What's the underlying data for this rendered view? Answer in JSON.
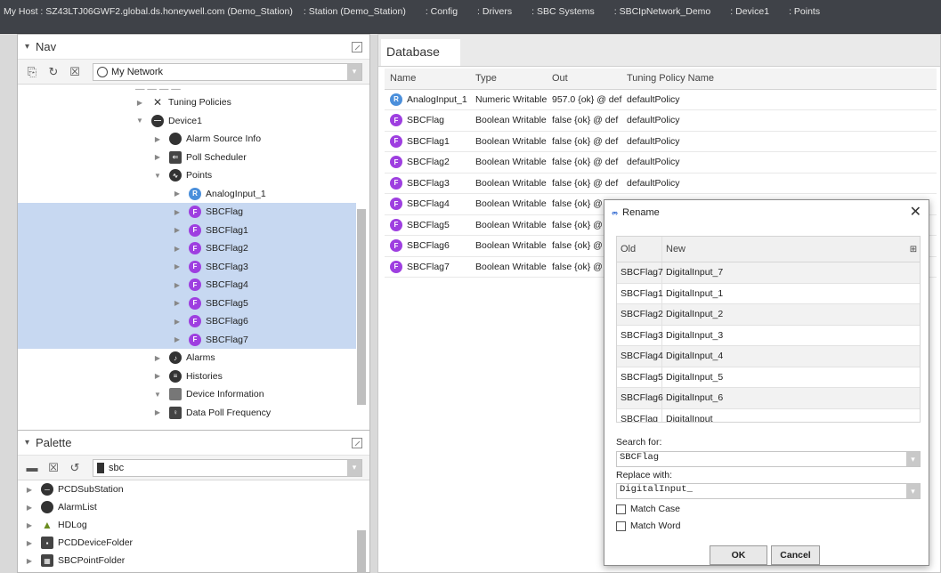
{
  "breadcrumb": [
    "My Host : SZ43LTJ06GWF2.global.ds.honeywell.com (Demo_Station)",
    ": Station (Demo_Station)",
    ": Config",
    ": Drivers",
    ": SBC Systems",
    ": SBCIpNetwork_Demo",
    ": Device1",
    ": Points"
  ],
  "nav": {
    "title": "Nav",
    "network_select": "My Network",
    "tree": [
      {
        "label": "Tuning Policies",
        "icon": "tuning-icon"
      },
      {
        "label": "Device1",
        "icon": "device-icon"
      },
      {
        "label": "Alarm Source Info",
        "icon": "alarm-source-icon"
      },
      {
        "label": "Poll Scheduler",
        "icon": "poll-scheduler-icon"
      },
      {
        "label": "Points",
        "icon": "points-icon"
      },
      {
        "label": "AnalogInput_1",
        "icon": "numeric-point-icon"
      },
      {
        "label": "SBCFlag",
        "icon": "boolean-point-icon"
      },
      {
        "label": "SBCFlag1",
        "icon": "boolean-point-icon"
      },
      {
        "label": "SBCFlag2",
        "icon": "boolean-point-icon"
      },
      {
        "label": "SBCFlag3",
        "icon": "boolean-point-icon"
      },
      {
        "label": "SBCFlag4",
        "icon": "boolean-point-icon"
      },
      {
        "label": "SBCFlag5",
        "icon": "boolean-point-icon"
      },
      {
        "label": "SBCFlag6",
        "icon": "boolean-point-icon"
      },
      {
        "label": "SBCFlag7",
        "icon": "boolean-point-icon"
      },
      {
        "label": "Alarms",
        "icon": "alarms-icon"
      },
      {
        "label": "Histories",
        "icon": "histories-icon"
      },
      {
        "label": "Device Information",
        "icon": "device-info-icon"
      },
      {
        "label": "Data Poll Frequency",
        "icon": "data-poll-icon"
      }
    ]
  },
  "palette": {
    "title": "Palette",
    "search": "sbc",
    "items": [
      "PCDSubStation",
      "AlarmList",
      "HDLog",
      "PCDDeviceFolder",
      "SBCPointFolder"
    ]
  },
  "database": {
    "tab": "Database",
    "columns": [
      "Name",
      "Type",
      "Out",
      "Tuning Policy Name"
    ],
    "rows": [
      {
        "badge": "R",
        "name": "AnalogInput_1",
        "type": "Numeric Writable",
        "out": "957.0 {ok} @ def",
        "policy": "defaultPolicy"
      },
      {
        "badge": "F",
        "name": "SBCFlag",
        "type": "Boolean Writable",
        "out": "false {ok} @ def",
        "policy": "defaultPolicy"
      },
      {
        "badge": "F",
        "name": "SBCFlag1",
        "type": "Boolean Writable",
        "out": "false {ok} @ def",
        "policy": "defaultPolicy"
      },
      {
        "badge": "F",
        "name": "SBCFlag2",
        "type": "Boolean Writable",
        "out": "false {ok} @ def",
        "policy": "defaultPolicy"
      },
      {
        "badge": "F",
        "name": "SBCFlag3",
        "type": "Boolean Writable",
        "out": "false {ok} @ def",
        "policy": "defaultPolicy"
      },
      {
        "badge": "F",
        "name": "SBCFlag4",
        "type": "Boolean Writable",
        "out": "false {ok} @ d",
        "policy": ""
      },
      {
        "badge": "F",
        "name": "SBCFlag5",
        "type": "Boolean Writable",
        "out": "false {ok} @",
        "policy": ""
      },
      {
        "badge": "F",
        "name": "SBCFlag6",
        "type": "Boolean Writable",
        "out": "false {ok} @",
        "policy": ""
      },
      {
        "badge": "F",
        "name": "SBCFlag7",
        "type": "Boolean Writable",
        "out": "false {ok} @",
        "policy": ""
      }
    ]
  },
  "rename_dialog": {
    "title": "Rename",
    "col_old": "Old",
    "col_new": "New",
    "rows": [
      {
        "old": "SBCFlag7",
        "new": "DigitalInput_7"
      },
      {
        "old": "SBCFlag1",
        "new": "DigitalInput_1"
      },
      {
        "old": "SBCFlag2",
        "new": "DigitalInput_2"
      },
      {
        "old": "SBCFlag3",
        "new": "DigitalInput_3"
      },
      {
        "old": "SBCFlag4",
        "new": "DigitalInput_4"
      },
      {
        "old": "SBCFlag5",
        "new": "DigitalInput_5"
      },
      {
        "old": "SBCFlag6",
        "new": "DigitalInput_6"
      },
      {
        "old": "SBCFlag",
        "new": "DigitalInput_"
      }
    ],
    "search_label": "Search for:",
    "search_value": "SBCFlag",
    "replace_label": "Replace with:",
    "replace_value": "DigitalInput_",
    "match_case": "Match Case",
    "match_word": "Match Word",
    "ok": "OK",
    "cancel": "Cancel"
  },
  "colors": {
    "selection": "#c7d8f1",
    "boolean_badge": "#9e3fe0",
    "numeric_badge": "#4b8fdb",
    "topbar": "#3f4248"
  }
}
